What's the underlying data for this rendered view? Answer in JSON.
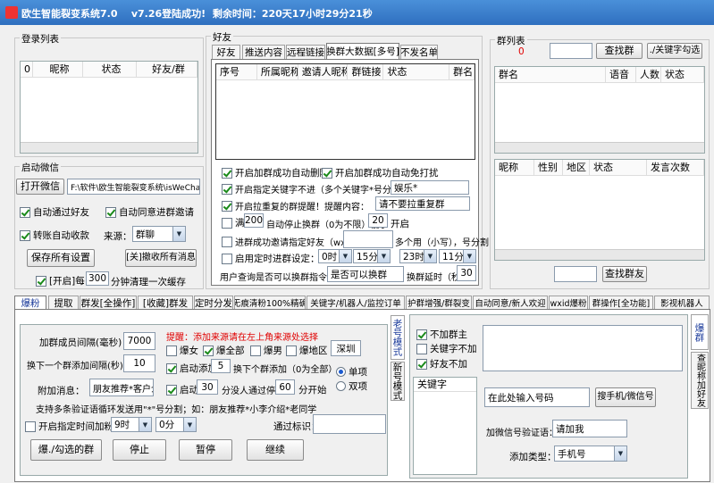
{
  "titlebar": {
    "app_name": "欧生智能裂变系统7.0",
    "version_status": "v7.26登陆成功!",
    "remaining_time": "剩余时间：220天17小时29分21秒"
  },
  "login_list": {
    "title": "登录列表",
    "columns": [
      "0",
      "昵称",
      "状态",
      "好友/群"
    ]
  },
  "launch_wechat": {
    "title": "启动微信",
    "open_button": "打开微信",
    "path": "F:\\软件\\欧生智能裂变系统\\isWeCha",
    "auto_accept_friend": "自动通过好友",
    "auto_accept_group_invite": "自动同意进群邀请",
    "auto_transfer": "转账自动收款",
    "source_label": "来源：",
    "source_value": "群聊",
    "save_settings": "保存所有设置",
    "close_all_messages": "[关]撤收所有消息",
    "clear_cache_prefix": "[开启]每",
    "clear_cache_minutes": "300",
    "clear_cache_suffix": "分钟清理一次缓存"
  },
  "friends_panel": {
    "title": "好友",
    "tabs": [
      "好友",
      "推送内容",
      "远程链接",
      "换群大数据[多号]",
      "不发名单"
    ],
    "columns": [
      "序号",
      "所属昵称",
      "邀请人昵称",
      "群链接",
      "状态",
      "群名"
    ],
    "opt1": "开启加群成功自动删除",
    "opt2": "开启加群成功自动免打扰",
    "opt3": "开启指定关键字不进（多个关键字*号分割）：",
    "opt3_value": "娱乐*",
    "opt4": "开启拉重复的群提醒！提醒内容：",
    "opt4_value": "请不要拉重复群",
    "full_prefix": "满",
    "full_count": "200",
    "full_mid": "自动停止换群（0为不限）低于",
    "full_low": "20",
    "full_suffix": "开启",
    "invite_label": "进群成功邀请指定好友（wxid）：",
    "invite_hint": "多个用（小写），号分割",
    "schedule_label": "启用定时进群设定：",
    "sched_h1": "0时",
    "sched_m1": "15分",
    "sched_h2": "23时",
    "sched_m2": "11分",
    "query_label": "用户查询是否可以换群指令：",
    "query_value": "是否可以换群",
    "delay_label": "换群延时（秒）",
    "delay_value": "30"
  },
  "group_list": {
    "title": "群列表",
    "count": "0",
    "find_group": "查找群",
    "keyword_select": "./关键字勾选",
    "columns": [
      "群名",
      "语音",
      "人数",
      "状态"
    ],
    "member_columns": [
      "昵称",
      "性别",
      "地区",
      "状态",
      "发言次数"
    ],
    "find_friend": "查找群友"
  },
  "bottom_tabs": [
    "爆粉",
    "提取",
    "群发[全操作]",
    "[收藏]群发",
    "定时分发",
    "无痕清粉100%精确",
    "关键字/机器人/监控订单",
    "护群增强/群裂变",
    "自动同意/新人欢迎",
    "wxid爆粉",
    "群操作[全功能]",
    "影视机器人"
  ],
  "burst": {
    "add_interval_label": "加群成员间隔(毫秒)",
    "add_interval_value": "7000",
    "switch_interval_label": "换下一个群添加间隔(秒)",
    "switch_interval_value": "10",
    "hint": "提醒：添加来源请在左上角来源处选择",
    "burst_female": "爆女",
    "burst_all": "爆全部",
    "burst_male": "爆男",
    "burst_region": "爆地区",
    "region_value": "深圳",
    "auto_add_label": "启动添加",
    "auto_add_value": "5",
    "auto_add_suffix": "换下个群添加（0为全部）",
    "single": "单项",
    "double": "双项",
    "attach_label": "附加消息：",
    "attach_value": "朋友推荐*客户介",
    "start_label": "启动",
    "start_value": "30",
    "start_mid": "分没人通过停",
    "start_value2": "60",
    "start_suffix": "分开始",
    "multi_hint": "支持多条验证语循环发送用\"*\"号分割；如：朋友推荐*小李介绍*老同学",
    "timed_label": "开启指定时间加粉：",
    "timed_h": "9时",
    "timed_m": "0分",
    "pass_label": "通过标识：",
    "btn_burst": "爆./勾选的群",
    "btn_stop": "停止",
    "btn_pause": "暂停",
    "btn_resume": "继续",
    "vtab_old": "老号模式",
    "vtab_new": "新号模式"
  },
  "add_friend": {
    "no_group_owner": "不加群主",
    "no_keyword": "关键字不加",
    "no_friend": "好友不加",
    "keyword_header": "关键字",
    "phone_placeholder": "在此处输入号码",
    "search_button": "搜手机/微信号",
    "verify_label": "加微信号验证语：",
    "verify_value": "请加我",
    "type_label": "添加类型：",
    "type_value": "手机号",
    "vtab_burst": "爆群",
    "vtab_quiet": "查昵称加好友"
  }
}
